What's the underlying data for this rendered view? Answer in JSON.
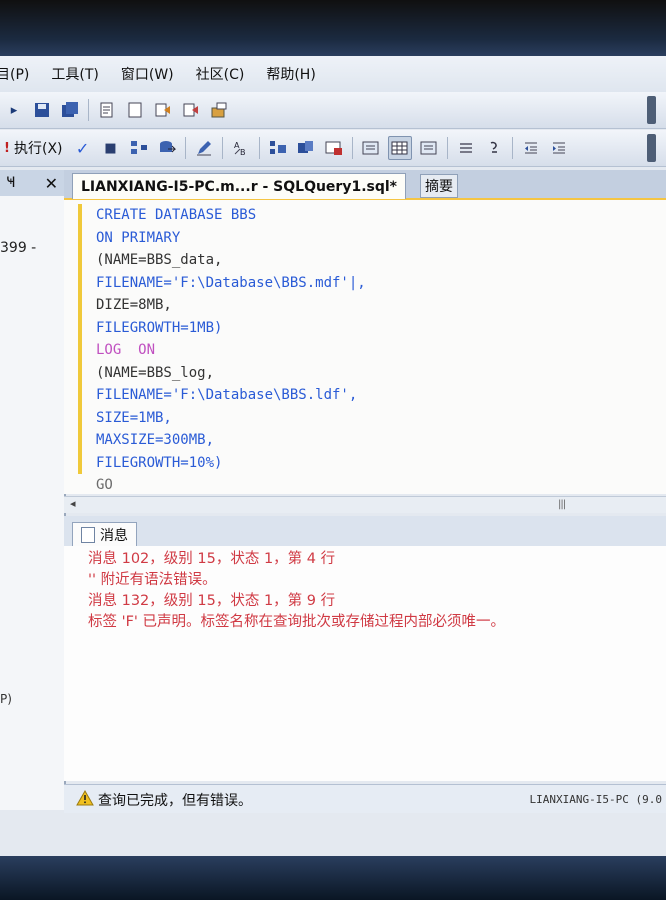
{
  "menu": {
    "items": [
      "目(P)",
      "工具(T)",
      "窗口(W)",
      "社区(C)",
      "帮助(H)"
    ]
  },
  "toolbar": {
    "execute_label": "执行(X)"
  },
  "left_panel": {
    "title": "Ҹ",
    "row_text": "399 -",
    "bottom_text": "P)"
  },
  "editor": {
    "tab_title": "LIANXIANG-I5-PC.m...r - SQLQuery1.sql*",
    "summary_tab": "摘要",
    "lines": [
      "CREATE DATABASE BBS",
      "ON PRIMARY",
      "(NAME=BBS_data,",
      "FILENAME='F:\\Database\\BBS.mdf'|,",
      "DIZE=8MB,",
      "FILEGROWTH=1MB)",
      "LOG  ON",
      "(NAME=BBS_log,",
      "FILENAME='F:\\Database\\BBS.ldf',",
      "SIZE=1MB,",
      "MAXSIZE=300MB,",
      "FILEGROWTH=10%)",
      "GO"
    ]
  },
  "messages": {
    "tab_label": "消息",
    "lines": [
      "消息 102，级别 15，状态 1，第 4 行",
      "'' 附近有语法错误。",
      "消息 132，级别 15，状态 1，第 9 行",
      "标签 'F' 已声明。标签名称在查询批次或存储过程内部必须唯一。"
    ]
  },
  "status": {
    "text": "查询已完成，但有错误。",
    "server": "LIANXIANG-I5-PC (9.0"
  },
  "colors": {
    "keyword": "#2a5bd6",
    "error": "#d03a44",
    "gutter": "#f0c93a"
  }
}
